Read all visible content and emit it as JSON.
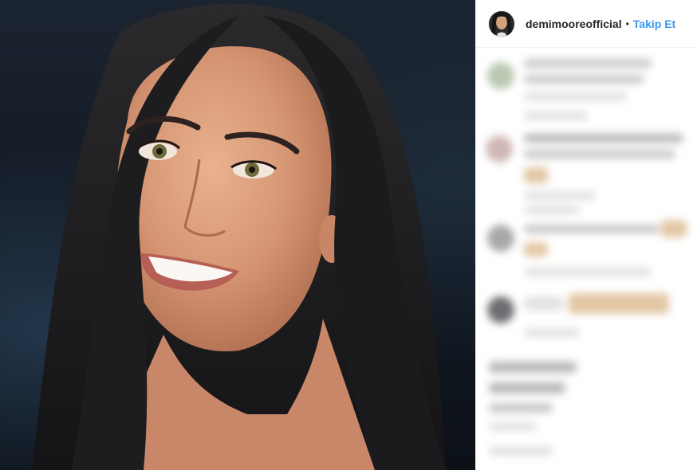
{
  "post": {
    "author": {
      "username": "demimooreofficial",
      "separator": "•",
      "follow_label": "Takip Et"
    }
  },
  "colors": {
    "link_blue": "#3897f0",
    "text_primary": "#262626",
    "border": "#efefef",
    "panel_bg": "#ffffff"
  },
  "icons": {
    "comment_avatars": [
      "blurred-avatar",
      "blurred-avatar",
      "blurred-avatar",
      "blurred-avatar"
    ]
  }
}
